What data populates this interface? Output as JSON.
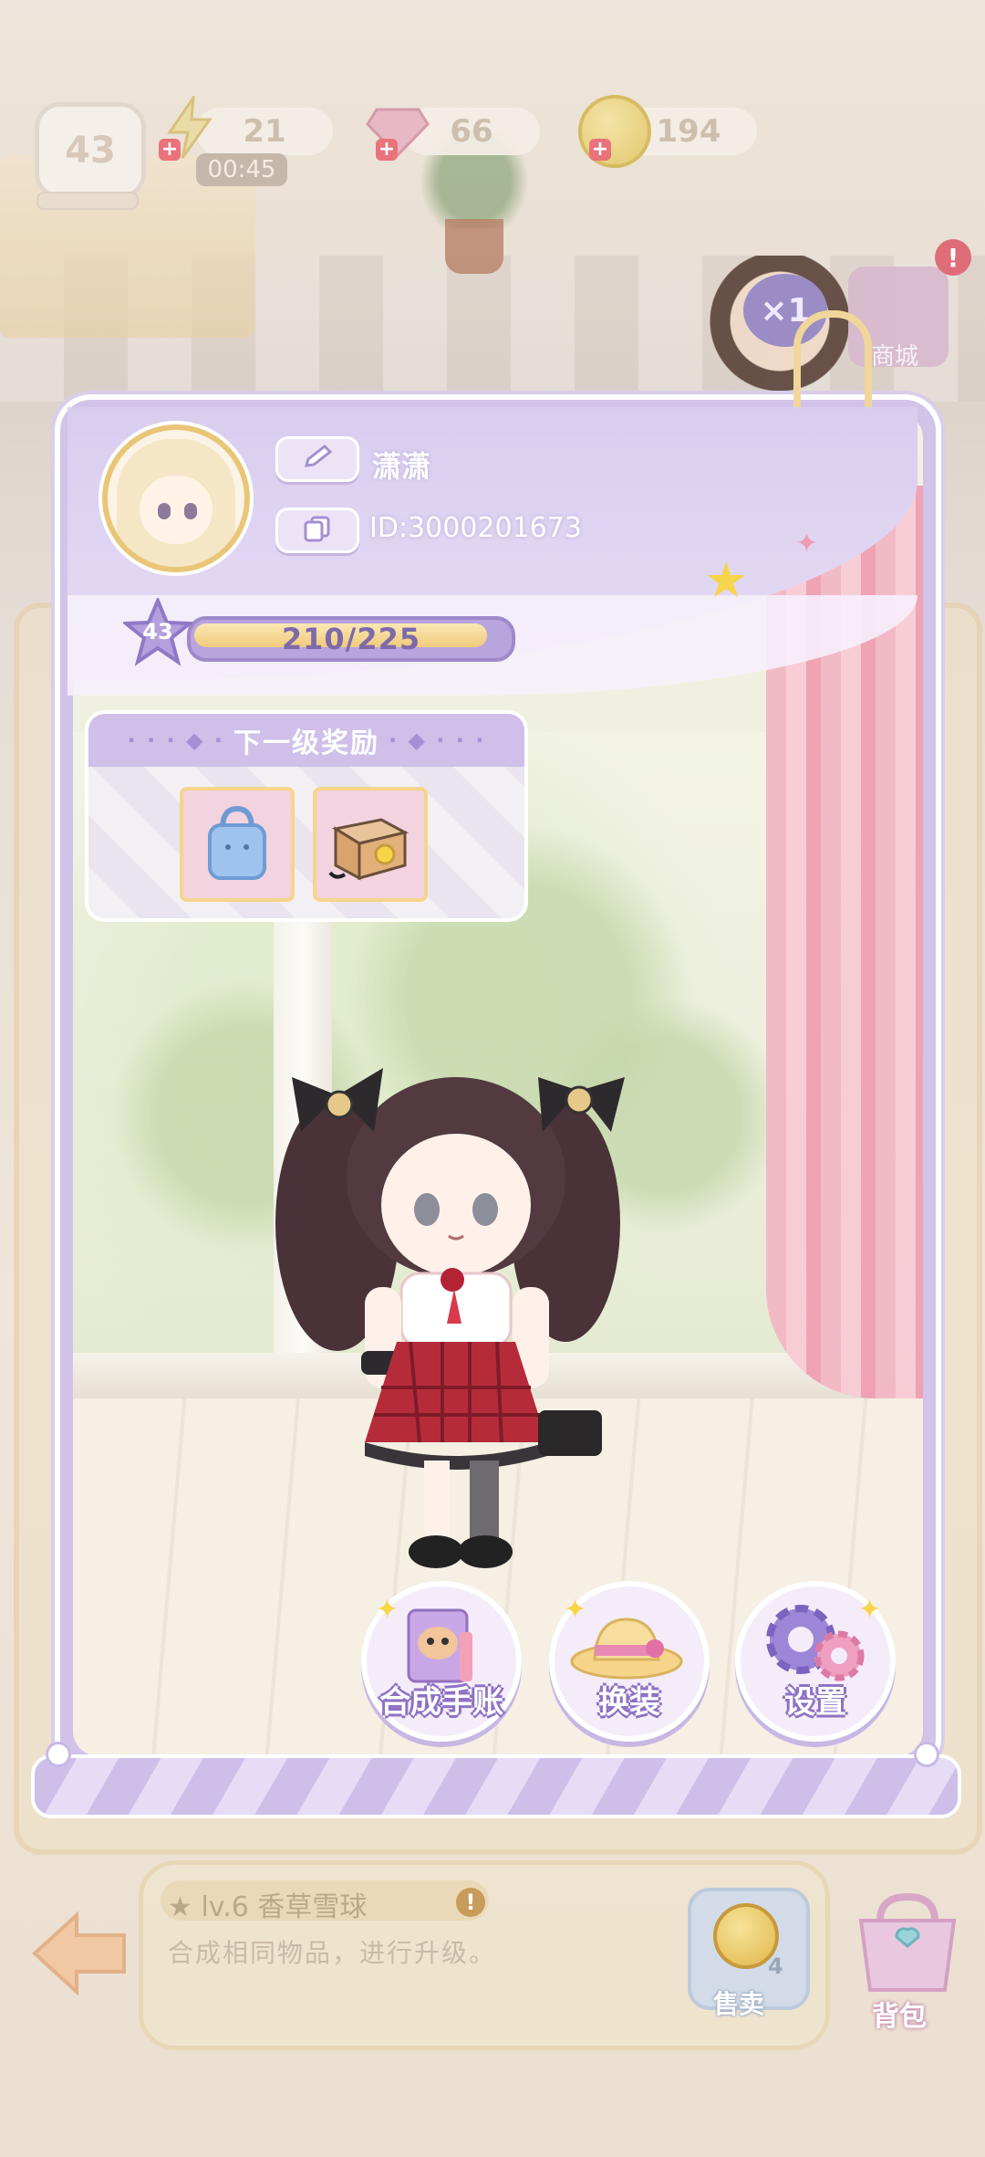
{
  "hud": {
    "level": "43",
    "energy": {
      "value": "21",
      "timer": "00:45"
    },
    "gems": {
      "value": "66"
    },
    "coins": {
      "value": "194"
    },
    "icons": [
      "lightning-icon",
      "gem-icon",
      "coin-icon"
    ]
  },
  "right_side": {
    "multiplier": "×1",
    "shop_label": "商城",
    "alert": "!"
  },
  "profile": {
    "name": "潇潇",
    "id": "ID:3000201673",
    "level": "43",
    "xp_text": "210/225",
    "xp_progress": 0.933,
    "edit_icon": "pencil-icon",
    "copy_icon": "copy-icon"
  },
  "reward": {
    "title": "下一级奖励",
    "items": [
      {
        "name": "blue-bag-icon"
      },
      {
        "name": "cardboard-box-icon"
      }
    ]
  },
  "actions": {
    "notebook": "合成手账",
    "dressup": "换装",
    "settings": "设置"
  },
  "item_info": {
    "title": "lv.6  香草雪球",
    "description": "合成相同物品，进行升级。",
    "alert": "!"
  },
  "sell": {
    "label": "售卖",
    "count": "4"
  },
  "bag": {
    "label": "背包"
  },
  "colors": {
    "panel_lilac": "#d2c3e8",
    "xp_fill": "#f0cb7c",
    "accent_purple": "#8d72c4",
    "curtain_pink": "#f2b7c4"
  }
}
